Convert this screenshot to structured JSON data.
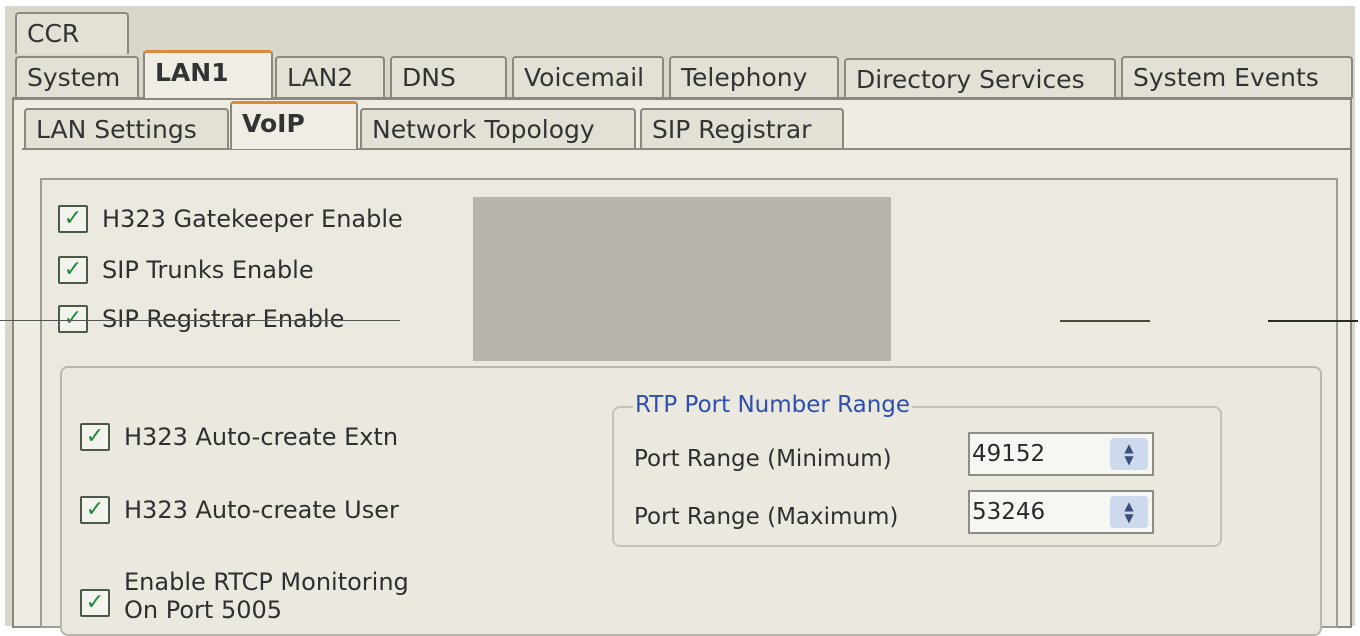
{
  "tabs_row0": [
    {
      "label": "CCR"
    }
  ],
  "tabs_row1": [
    {
      "label": "System"
    },
    {
      "label": "LAN1"
    },
    {
      "label": "LAN2"
    },
    {
      "label": "DNS"
    },
    {
      "label": "Voicemail"
    },
    {
      "label": "Telephony"
    },
    {
      "label": "Directory Services"
    },
    {
      "label": "System Events"
    }
  ],
  "active_tab_row1": "LAN1",
  "tabs_row2": [
    {
      "label": "LAN Settings"
    },
    {
      "label": "VoIP"
    },
    {
      "label": "Network Topology"
    },
    {
      "label": "SIP Registrar"
    }
  ],
  "active_tab_row2": "VoIP",
  "voip": {
    "h323_gatekeeper": {
      "label": "H323 Gatekeeper Enable",
      "checked": true
    },
    "sip_trunks": {
      "label": "SIP Trunks Enable",
      "checked": true
    },
    "sip_registrar": {
      "label": "SIP Registrar Enable",
      "checked": true
    },
    "h323_auto_extn": {
      "label": "H323 Auto-create Extn",
      "checked": true
    },
    "h323_auto_user": {
      "label": "H323 Auto-create User",
      "checked": true
    },
    "rtcp_monitoring": {
      "label_line1": "Enable RTCP Monitoring",
      "label_line2": "On Port 5005",
      "checked": true
    }
  },
  "rtp": {
    "title": "RTP Port Number Range",
    "min_label": "Port Range (Minimum)",
    "min_value": "49152",
    "max_label": "Port Range (Maximum)",
    "max_value": "53246"
  },
  "icons": {
    "check": "check-icon",
    "spin": "spin-arrows-icon"
  },
  "colors": {
    "accent_tab": "#d98a3a",
    "group_title": "#2c4fb0",
    "check": "#1f8a3a"
  }
}
